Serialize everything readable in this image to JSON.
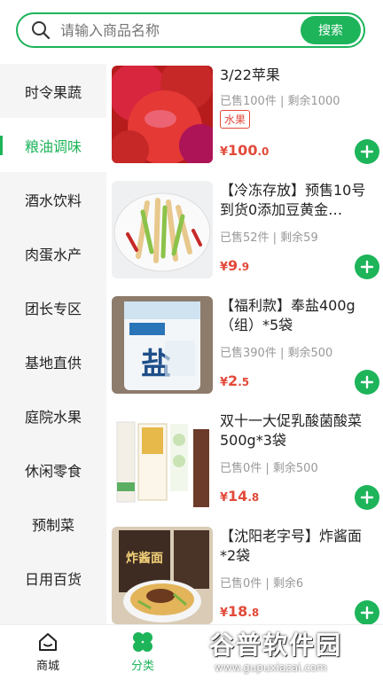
{
  "search": {
    "placeholder": "请输入商品名称",
    "button_label": "搜索"
  },
  "sidebar": {
    "items": [
      {
        "label": "时令果蔬",
        "active": false
      },
      {
        "label": "粮油调味",
        "active": true
      },
      {
        "label": "酒水饮料",
        "active": false
      },
      {
        "label": "肉蛋水产",
        "active": false
      },
      {
        "label": "团长专区",
        "active": false
      },
      {
        "label": "基地直供",
        "active": false
      },
      {
        "label": "庭院水果",
        "active": false
      },
      {
        "label": "休闲零食",
        "active": false
      },
      {
        "label": "预制菜",
        "active": false
      },
      {
        "label": "日用百货",
        "active": false
      }
    ]
  },
  "products": [
    {
      "title": "3/22苹果",
      "stats": "已售100件 | 剩余1000",
      "tag": "水果",
      "price_symbol": "¥",
      "price_int": "100",
      "price_dec": ".0",
      "image": "apple"
    },
    {
      "title": "【冷冻存放】预售10号到货0添加豆黄金…",
      "stats": "已售52件 | 剩余59",
      "tag": "",
      "price_symbol": "¥",
      "price_int": "9",
      "price_dec": ".9",
      "image": "tofu-skin-dish"
    },
    {
      "title": "【福利款】奉盐400g（组）*5袋",
      "stats": "已售390件 | 剩余500",
      "tag": "",
      "price_symbol": "¥",
      "price_int": "2",
      "price_dec": ".5",
      "image": "salt-bag"
    },
    {
      "title": "双十一大促乳酸菌酸菜500g*3袋",
      "stats": "已售0件 | 剩余500",
      "tag": "",
      "price_symbol": "¥",
      "price_int": "14",
      "price_dec": ".8",
      "image": "sauerkraut-pack"
    },
    {
      "title": "【沈阳老字号】炸酱面*2袋",
      "stats": "已售0件 | 剩余6",
      "tag": "",
      "price_symbol": "¥",
      "price_int": "18",
      "price_dec": ".8",
      "image": "noodle-pack"
    }
  ],
  "bottom_nav": [
    {
      "label": "商城",
      "icon": "home-icon",
      "active": false
    },
    {
      "label": "分类",
      "icon": "clover-icon",
      "active": true
    }
  ],
  "watermark": {
    "main": "谷普软件园",
    "url": "www.gupuxiazai.com"
  },
  "colors": {
    "accent": "#1db45a",
    "price": "#e24a3a",
    "muted": "#999999"
  }
}
